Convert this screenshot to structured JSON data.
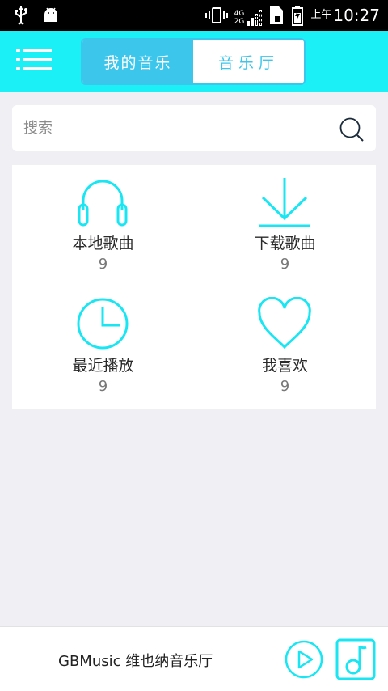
{
  "status_bar": {
    "icons": [
      "usb-icon",
      "android-icon",
      "vibrate-icon",
      "signal-4g2g-icon",
      "sim-icon",
      "battery-icon"
    ],
    "network": "4G",
    "network2": "2G",
    "am_pm": "上午",
    "time": "10:27"
  },
  "header": {
    "menu_icon": "hamburger-menu-icon",
    "tabs": [
      {
        "label": "我的音乐",
        "active": true
      },
      {
        "label": "音乐厅",
        "active": false
      }
    ]
  },
  "search": {
    "placeholder": "搜索",
    "icon": "search-icon"
  },
  "library": {
    "items": [
      {
        "label": "本地歌曲",
        "count": "9",
        "icon": "headphones-icon"
      },
      {
        "label": "下载歌曲",
        "count": "9",
        "icon": "download-icon"
      },
      {
        "label": "最近播放",
        "count": "9",
        "icon": "clock-icon"
      },
      {
        "label": "我喜欢",
        "count": "9",
        "icon": "heart-icon"
      }
    ]
  },
  "player": {
    "title": "GBMusic 维也纳音乐厅",
    "play_icon": "play-icon",
    "note_icon": "music-note-icon"
  },
  "colors": {
    "accent": "#1bf0f7",
    "tab_active": "#3cc6ec",
    "icon_cyan": "#19e6f2",
    "background": "#efeff4"
  }
}
